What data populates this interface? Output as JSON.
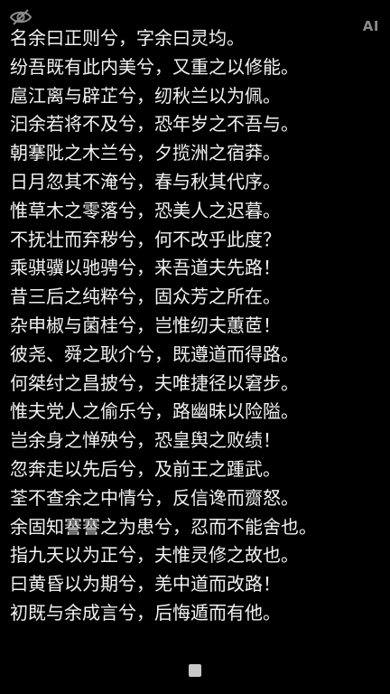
{
  "toolbar": {
    "left_icon": "eye-off-icon",
    "right_label": "AI"
  },
  "poem": {
    "lines": [
      "名余曰正则兮，字余曰灵均。",
      "纷吾既有此内美兮，又重之以修能。",
      "扈江离与辟芷兮，纫秋兰以为佩。",
      "汩余若将不及兮，恐年岁之不吾与。",
      "朝搴阰之木兰兮，夕揽洲之宿莽。",
      "日月忽其不淹兮，春与秋其代序。",
      "惟草木之零落兮，恐美人之迟暮。",
      "不抚壮而弃秽兮，何不改乎此度？",
      "乘骐骥以驰骋兮，来吾道夫先路！",
      "昔三后之纯粹兮，固众芳之所在。",
      "杂申椒与菌桂兮，岂惟纫夫蕙茝！",
      "彼尧、舜之耿介兮，既遵道而得路。",
      "何桀纣之昌披兮，夫唯捷径以窘步。",
      "惟夫党人之偷乐兮，路幽昧以险隘。",
      "岂余身之惮殃兮，恐皇舆之败绩！",
      "忽奔走以先后兮，及前王之踵武。",
      "荃不查余之中情兮，反信谗而齌怒。",
      "余固知謇謇之为患兮，忍而不能舍也。",
      "指九天以为正兮，夫惟灵修之故也。",
      "曰黄昏以为期兮，羌中道而改路！",
      "初既与余成言兮，后悔遁而有他。"
    ]
  },
  "colors": {
    "background": "#000000",
    "text": "#f2f2f2",
    "icon": "#8a8a8a",
    "handle": "#c9c9c9"
  },
  "bottom": {
    "handle_icon": "square-handle-icon"
  }
}
